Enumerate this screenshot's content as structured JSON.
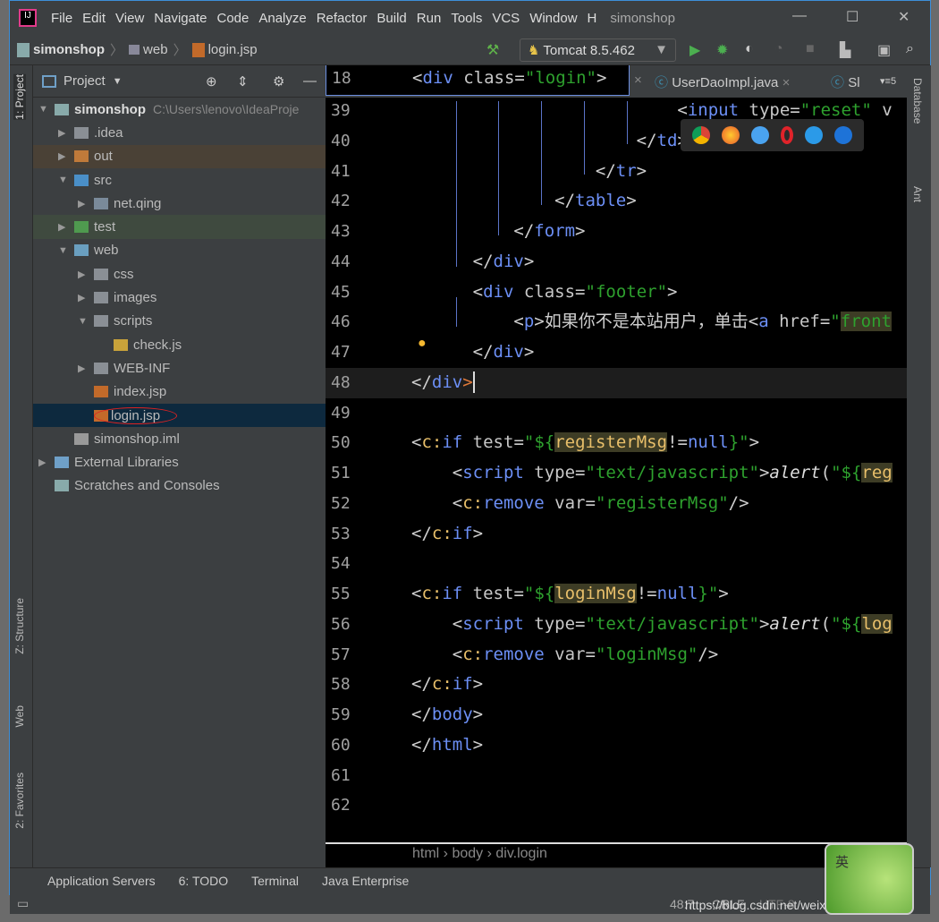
{
  "menu": {
    "items": [
      "File",
      "Edit",
      "View",
      "Navigate",
      "Code",
      "Analyze",
      "Refactor",
      "Build",
      "Run",
      "Tools",
      "VCS",
      "Window",
      "H"
    ],
    "title": "simonshop"
  },
  "nav": {
    "project": "simonshop",
    "folder": "web",
    "file": "login.jsp",
    "run_config": "Tomcat 8.5.462"
  },
  "left_tabs": [
    "1: Project",
    "Z: Structure",
    "Web",
    "2: Favorites"
  ],
  "right_tabs": [
    "Database",
    "Ant"
  ],
  "project": {
    "header": "Project",
    "tree": [
      {
        "label": "simonshop",
        "extra": "C:\\Users\\lenovo\\IdeaProje",
        "level": 0,
        "arrow": "▼",
        "icon": "module",
        "bold": true
      },
      {
        "label": ".idea",
        "level": 1,
        "arrow": "▶",
        "icon": "folder"
      },
      {
        "label": "out",
        "level": 1,
        "arrow": "▶",
        "icon": "folder-orange",
        "hl": "#4a4136"
      },
      {
        "label": "src",
        "level": 1,
        "arrow": "▼",
        "icon": "folder-blue"
      },
      {
        "label": "net.qing",
        "level": 2,
        "arrow": "▶",
        "icon": "package"
      },
      {
        "label": "test",
        "level": 1,
        "arrow": "▶",
        "icon": "folder-green",
        "hl": "#3f4a3f"
      },
      {
        "label": "web",
        "level": 1,
        "arrow": "▼",
        "icon": "folder-web"
      },
      {
        "label": "css",
        "level": 2,
        "arrow": "▶",
        "icon": "folder"
      },
      {
        "label": "images",
        "level": 2,
        "arrow": "▶",
        "icon": "folder"
      },
      {
        "label": "scripts",
        "level": 2,
        "arrow": "▼",
        "icon": "folder"
      },
      {
        "label": "check.js",
        "level": 3,
        "arrow": "",
        "icon": "js-file"
      },
      {
        "label": "WEB-INF",
        "level": 2,
        "arrow": "▶",
        "icon": "folder"
      },
      {
        "label": "index.jsp",
        "level": 2,
        "arrow": "",
        "icon": "jsp-file"
      },
      {
        "label": "login.jsp",
        "level": 2,
        "arrow": "",
        "icon": "jsp-file",
        "selected": true
      },
      {
        "label": "simonshop.iml",
        "level": 1,
        "arrow": "",
        "icon": "iml-file"
      },
      {
        "label": "External Libraries",
        "level": 0,
        "arrow": "▶",
        "icon": "library"
      },
      {
        "label": "Scratches and Consoles",
        "level": 0,
        "arrow": "",
        "icon": "scratches"
      }
    ]
  },
  "tabs": [
    {
      "label": "UserDaoImpl.java"
    },
    {
      "label": "Sl"
    }
  ],
  "tab_count": "5",
  "sticky": {
    "no": "18",
    "tokens": [
      [
        "<",
        "p"
      ],
      [
        "div",
        "k"
      ],
      [
        " class",
        "a"
      ],
      [
        "=",
        "p"
      ],
      [
        "\"login\"",
        "s"
      ],
      [
        ">",
        "p"
      ]
    ]
  },
  "code": [
    {
      "no": "39",
      "tokens": [
        [
          "                          <",
          "p"
        ],
        [
          "input",
          "k"
        ],
        [
          " type",
          "a"
        ],
        [
          "=",
          "p"
        ],
        [
          "\"reset\"",
          "s"
        ],
        [
          " v",
          "a"
        ]
      ]
    },
    {
      "no": "40",
      "tokens": [
        [
          "                      </",
          "p"
        ],
        [
          "td",
          "k"
        ],
        [
          ">",
          "p"
        ]
      ]
    },
    {
      "no": "41",
      "tokens": [
        [
          "                  </",
          "p"
        ],
        [
          "tr",
          "k"
        ],
        [
          ">",
          "p"
        ]
      ]
    },
    {
      "no": "42",
      "tokens": [
        [
          "              </",
          "p"
        ],
        [
          "table",
          "k"
        ],
        [
          ">",
          "p"
        ]
      ]
    },
    {
      "no": "43",
      "tokens": [
        [
          "          </",
          "p"
        ],
        [
          "form",
          "k"
        ],
        [
          ">",
          "p"
        ]
      ]
    },
    {
      "no": "44",
      "tokens": [
        [
          "      </",
          "p"
        ],
        [
          "div",
          "k"
        ],
        [
          ">",
          "p"
        ]
      ]
    },
    {
      "no": "45",
      "tokens": [
        [
          "      <",
          "p"
        ],
        [
          "div",
          "k"
        ],
        [
          " class",
          "a"
        ],
        [
          "=",
          "p"
        ],
        [
          "\"footer\"",
          "s"
        ],
        [
          ">",
          "p"
        ]
      ]
    },
    {
      "no": "46",
      "tokens": [
        [
          "          <",
          "p"
        ],
        [
          "p",
          "k"
        ],
        [
          ">如果你不是本站用户，单击<",
          "p"
        ],
        [
          "a",
          "k"
        ],
        [
          " href",
          "a"
        ],
        [
          "=",
          "p"
        ],
        [
          "\"",
          "s"
        ],
        [
          "front",
          "s h"
        ]
      ]
    },
    {
      "no": "47",
      "tokens": [
        [
          "      </",
          "p"
        ],
        [
          "div",
          "k"
        ],
        [
          ">",
          "p"
        ]
      ]
    },
    {
      "no": "48",
      "tokens": [
        [
          "</",
          "p"
        ],
        [
          "div",
          "k"
        ],
        [
          ">",
          "o"
        ]
      ],
      "current": true
    },
    {
      "no": "49",
      "tokens": []
    },
    {
      "no": "50",
      "tokens": [
        [
          "<",
          "p"
        ],
        [
          "c:",
          "e"
        ],
        [
          "if",
          "k"
        ],
        [
          " test",
          "a"
        ],
        [
          "=",
          "p"
        ],
        [
          "\"${",
          "s"
        ],
        [
          "registerMsg",
          "e h"
        ],
        [
          "!=",
          "p"
        ],
        [
          "null",
          "k"
        ],
        [
          "}\"",
          "s"
        ],
        [
          ">",
          "p"
        ]
      ]
    },
    {
      "no": "51",
      "tokens": [
        [
          "    <",
          "p"
        ],
        [
          "script",
          "k"
        ],
        [
          " type",
          "a"
        ],
        [
          "=",
          "p"
        ],
        [
          "\"text/javascript\"",
          "s"
        ],
        [
          ">",
          "p"
        ],
        [
          "alert",
          "i"
        ],
        [
          "(",
          "p"
        ],
        [
          "\"${",
          "s"
        ],
        [
          "reg",
          "e h"
        ]
      ]
    },
    {
      "no": "52",
      "tokens": [
        [
          "    <",
          "p"
        ],
        [
          "c:",
          "e"
        ],
        [
          "remove",
          "k"
        ],
        [
          " var",
          "a"
        ],
        [
          "=",
          "p"
        ],
        [
          "\"registerMsg\"",
          "s"
        ],
        [
          "/>",
          "p"
        ]
      ]
    },
    {
      "no": "53",
      "tokens": [
        [
          "</",
          "p"
        ],
        [
          "c:",
          "e"
        ],
        [
          "if",
          "k"
        ],
        [
          ">",
          "p"
        ]
      ]
    },
    {
      "no": "54",
      "tokens": []
    },
    {
      "no": "55",
      "tokens": [
        [
          "<",
          "p"
        ],
        [
          "c:",
          "e"
        ],
        [
          "if",
          "k"
        ],
        [
          " test",
          "a"
        ],
        [
          "=",
          "p"
        ],
        [
          "\"${",
          "s"
        ],
        [
          "loginMsg",
          "e h"
        ],
        [
          "!=",
          "p"
        ],
        [
          "null",
          "k"
        ],
        [
          "}\"",
          "s"
        ],
        [
          ">",
          "p"
        ]
      ]
    },
    {
      "no": "56",
      "tokens": [
        [
          "    <",
          "p"
        ],
        [
          "script",
          "k"
        ],
        [
          " type",
          "a"
        ],
        [
          "=",
          "p"
        ],
        [
          "\"text/javascript\"",
          "s"
        ],
        [
          ">",
          "p"
        ],
        [
          "alert",
          "i"
        ],
        [
          "(",
          "p"
        ],
        [
          "\"${",
          "s"
        ],
        [
          "log",
          "e h"
        ]
      ]
    },
    {
      "no": "57",
      "tokens": [
        [
          "    <",
          "p"
        ],
        [
          "c:",
          "e"
        ],
        [
          "remove",
          "k"
        ],
        [
          " var",
          "a"
        ],
        [
          "=",
          "p"
        ],
        [
          "\"loginMsg\"",
          "s"
        ],
        [
          "/>",
          "p"
        ]
      ]
    },
    {
      "no": "58",
      "tokens": [
        [
          "</",
          "p"
        ],
        [
          "c:",
          "e"
        ],
        [
          "if",
          "k"
        ],
        [
          ">",
          "p"
        ]
      ]
    },
    {
      "no": "59",
      "tokens": [
        [
          "</",
          "p"
        ],
        [
          "body",
          "k"
        ],
        [
          ">",
          "p"
        ]
      ]
    },
    {
      "no": "60",
      "tokens": [
        [
          "</",
          "p"
        ],
        [
          "html",
          "k"
        ],
        [
          ">",
          "p"
        ]
      ]
    },
    {
      "no": "61",
      "tokens": []
    },
    {
      "no": "62",
      "tokens": []
    }
  ],
  "breadcrumbs": [
    "html",
    "body",
    "div.login"
  ],
  "bottom_tools": [
    "Application Servers",
    "6: TODO",
    "Terminal",
    "Java Enterprise"
  ],
  "status": {
    "position": "48:7",
    "line_sep": "CRLF",
    "encoding": "UTF-8",
    "watermark": "https://blog.csdn.net/weixin_44202489"
  },
  "browsers": [
    "chrome-icon",
    "firefox-icon",
    "safari-icon",
    "opera-icon",
    "ie-icon",
    "edge-icon"
  ],
  "ime": "英"
}
